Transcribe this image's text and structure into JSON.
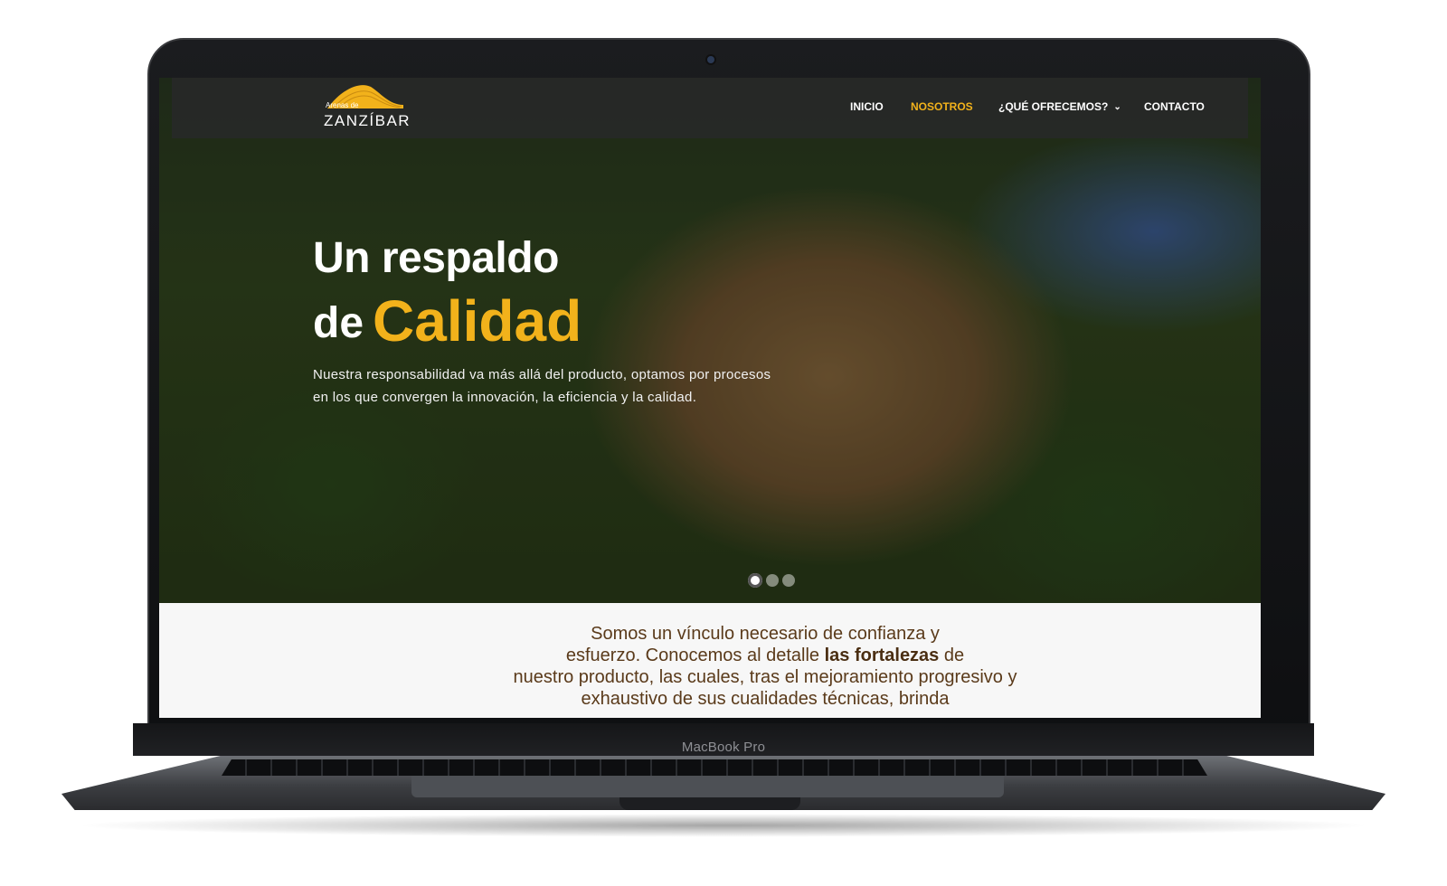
{
  "device": {
    "label": "MacBook Pro"
  },
  "site": {
    "logo": {
      "small_text": "Arenas de",
      "large_text": "ZANZÍBAR"
    },
    "nav": {
      "items": [
        {
          "label": "INICIO",
          "active": false
        },
        {
          "label": "NOSOTROS",
          "active": true
        },
        {
          "label": "¿QUÉ OFRECEMOS?",
          "active": false,
          "has_dropdown": true
        },
        {
          "label": "CONTACTO",
          "active": false
        }
      ]
    },
    "hero": {
      "title_line1": "Un respaldo",
      "title_line2_prefix": "de",
      "title_line2_accent": "Calidad",
      "description_line1": "Nuestra responsabilidad va más allá del producto, optamos por procesos",
      "description_line2": "en los que convergen la innovación, la eficiencia y la calidad.",
      "slider": {
        "total": 3,
        "active_index": 0
      }
    },
    "about": {
      "line1": "Somos un vínculo necesario de confianza y",
      "line2_before": "esfuerzo. Conocemos al detalle",
      "line2_bold": "las fortalezas",
      "line2_after": "de",
      "line3": "nuestro producto, las cuales, tras el mejoramiento progresivo y",
      "line4": "exhaustivo de sus cualidades técnicas, brinda"
    },
    "colors": {
      "accent": "#f2b21b",
      "nav_bg": "#28282a",
      "about_text": "#5a3a1a"
    },
    "icons": [
      "chevron-down-icon",
      "logo-wave-icon"
    ]
  }
}
